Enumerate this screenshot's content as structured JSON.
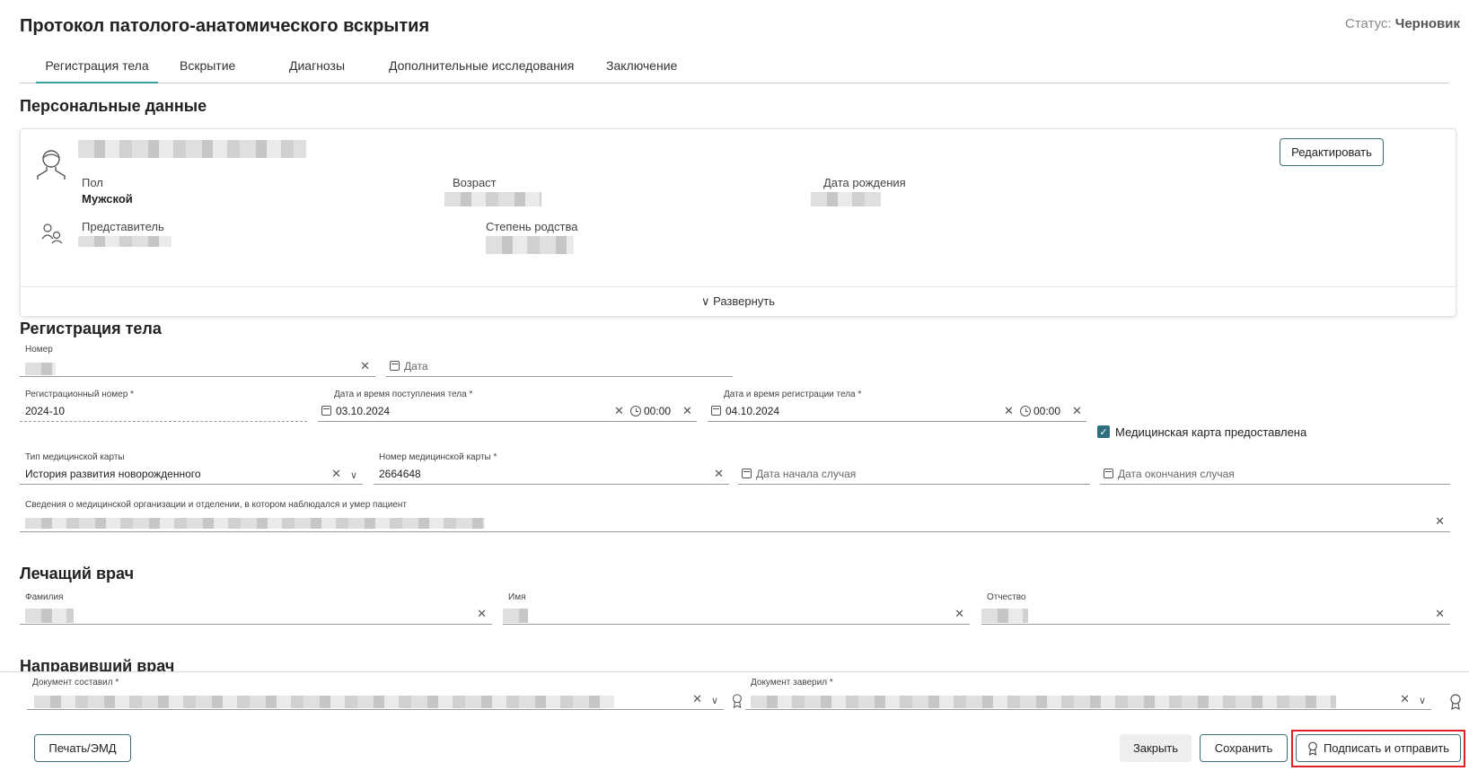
{
  "header": {
    "title": "Протокол патолого-анатомического вскрытия",
    "status_label": "Статус:",
    "status_value": "Черновик"
  },
  "tabs": [
    {
      "label": "Регистрация тела",
      "active": true
    },
    {
      "label": "Вскрытие",
      "active": false
    },
    {
      "label": "Диагнозы",
      "active": false
    },
    {
      "label": "Дополнительные исследования",
      "active": false
    },
    {
      "label": "Заключение",
      "active": false
    }
  ],
  "personal": {
    "section_title": "Персональные данные",
    "edit_button": "Редактировать",
    "sex_label": "Пол",
    "sex_value": "Мужской",
    "age_label": "Возраст",
    "dob_label": "Дата рождения",
    "representative_label": "Представитель",
    "kinship_label": "Степень родства",
    "expand_label": "Развернуть"
  },
  "registration": {
    "section_title": "Регистрация тела",
    "number_label": "Номер",
    "date_placeholder": "Дата",
    "reg_number_label": "Регистрационный номер *",
    "reg_number_value": "2024-10",
    "arrival_label": "Дата и время поступления тела *",
    "arrival_date": "03.10.2024",
    "arrival_time": "00:00",
    "registration_label": "Дата и время регистрации тела *",
    "registration_date": "04.10.2024",
    "registration_time": "00:00",
    "med_card_checkbox_label": "Медицинская карта предоставлена",
    "med_card_checked": true,
    "card_type_label": "Тип медицинской карты",
    "card_type_value": "История развития новорожденного",
    "card_number_label": "Номер медицинской карты *",
    "card_number_value": "2664648",
    "case_start_placeholder": "Дата начала случая",
    "case_end_placeholder": "Дата окончания случая",
    "org_info_label": "Сведения о медицинской организации и отделении, в котором наблюдался и умер пациент"
  },
  "attending": {
    "section_title": "Лечащий врач",
    "surname_label": "Фамилия",
    "name_label": "Имя",
    "patronymic_label": "Отчество"
  },
  "referring": {
    "section_title": "Направивший врач"
  },
  "footer": {
    "doc_composed_label": "Документ составил *",
    "doc_certified_label": "Документ заверил *",
    "print_button": "Печать/ЭМД",
    "close_button": "Закрыть",
    "save_button": "Сохранить",
    "sign_send_button": "Подписать и отправить"
  },
  "colors": {
    "accent": "#3f9fa7",
    "checkbox": "#2f6f80",
    "highlight": "#e0202a"
  }
}
